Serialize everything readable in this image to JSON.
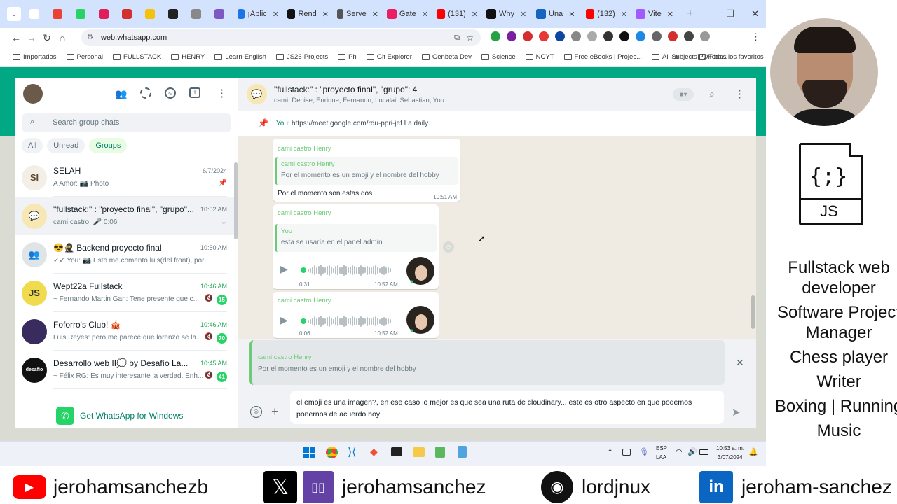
{
  "browser": {
    "tabs": [
      {
        "label": "",
        "color": "#ffffff"
      },
      {
        "label": "",
        "color": "#ea4335"
      },
      {
        "label": "",
        "color": "#25d366"
      },
      {
        "label": "",
        "color": "#e01e5a"
      },
      {
        "label": "",
        "color": "#d32f2f"
      },
      {
        "label": "",
        "color": "#f4c20d"
      },
      {
        "label": "",
        "color": "#222222"
      },
      {
        "label": "",
        "color": "#888888"
      },
      {
        "label": "",
        "color": "#7e57c2"
      },
      {
        "label": "¡Aplic",
        "color": "#1a73e8"
      },
      {
        "label": "Rend",
        "color": "#111111"
      },
      {
        "label": "Serve",
        "color": "#555555"
      },
      {
        "label": "Gate",
        "color": "#e91e63"
      },
      {
        "label": "(131)",
        "color": "#ff0000"
      },
      {
        "label": "Why",
        "color": "#111111"
      },
      {
        "label": "Una",
        "color": "#1565c0"
      },
      {
        "label": "(132)",
        "color": "#ff0000"
      },
      {
        "label": "Vite",
        "color": "#a259ff"
      }
    ],
    "url": "web.whatsapp.com",
    "bookmarks": [
      "Importados",
      "Personal",
      "FULLSTACK",
      "HENRY",
      "Learn-English",
      "JS26-Projects",
      "Ph",
      "Git Explorer",
      "Genbeta Dev",
      "Science",
      "NCYT",
      "Free eBooks | Projec...",
      "All Subjects PDF bo..."
    ],
    "bookmarks_more": "»",
    "all_bookmarks": "Todos los favoritos"
  },
  "sidebar": {
    "search_placeholder": "Search group chats",
    "filters": [
      "All",
      "Unread",
      "Groups"
    ],
    "chats": [
      {
        "name": "SELAH",
        "time": "6/7/2024",
        "msg": "A Amor: 📷 Photo",
        "avatar": "SI",
        "avatar_bg": "#f3efe6",
        "avatar_fg": "#5a4a2a",
        "badge": "",
        "pin": true
      },
      {
        "name": "\"fullstack:\" : \"proyecto final\", \"grupo\"...",
        "time": "10:52 AM",
        "msg": "cami castro: 🎤 0:06",
        "avatar": "💬",
        "avatar_bg": "#f7e7b5",
        "avatar_fg": "#777",
        "badge": "",
        "selected": true
      },
      {
        "name": "😎🥷 Backend proyecto final",
        "time": "10:50 AM",
        "msg": "✓✓ You: 📷 Esto me comentó luis(del front), por inter...",
        "avatar": "👥",
        "avatar_bg": "#dfe5e7",
        "avatar_fg": "#fff",
        "badge": ""
      },
      {
        "name": "Wept22a Fullstack",
        "time": "10:46 AM",
        "msg": "~ Fernando Martin Gan: Tene presente que c...",
        "avatar": "JS",
        "avatar_bg": "#f0db4f",
        "avatar_fg": "#323330",
        "badge": "15"
      },
      {
        "name": "Foforro's Club! 🎪",
        "time": "10:46 AM",
        "msg": "Luis Reyes: pero me parece que lorenzo se la...",
        "avatar": "",
        "avatar_bg": "#3a2b5e",
        "avatar_fg": "#fff",
        "badge": "70"
      },
      {
        "name": "Desarrollo web II💭   by Desafío La...",
        "time": "10:45 AM",
        "msg": "~ Félix RG: Es muy interesante la verdad. Enh...",
        "avatar": "desafío",
        "avatar_bg": "#111111",
        "avatar_fg": "#fff",
        "badge": "41"
      }
    ],
    "get_app": "Get WhatsApp for Windows"
  },
  "chat": {
    "title": "\"fullstack:\" : \"proyecto final\", \"grupo\": 4",
    "members": "cami, Denise, Enrique, Fernando, Lucalai, Sebastian, You",
    "pinned_sender": "You:",
    "pinned_text": "https://meet.google.com/rdu-ppri-jef La daily.",
    "messages": {
      "m1_sender": "cami castro Henry",
      "m1_quote_name": "cami castro Henry",
      "m1_quote_text": "Por el momento es un emoji y el nombre del hobby",
      "m1_text": "Por el momento son estas dos",
      "m1_time": "10:51 AM",
      "m2_sender": "cami castro Henry",
      "m2_quote_name": "You",
      "m2_quote_text": "esta se usaría en el panel admin",
      "m2_duration": "0:31",
      "m2_time": "10:52 AM",
      "m3_sender": "cami castro Henry",
      "m3_duration": "0:06",
      "m3_time": "10:52 AM"
    },
    "reply_name": "cami castro Henry",
    "reply_text": "Por el momento es un emoji y el nombre del hobby",
    "composer_text": "el emoji es una imagen?, en ese caso lo mejor es que sea una ruta de cloudinary... este es otro aspecto en que podemos ponernos de acuerdo hoy"
  },
  "taskbar": {
    "lang1": "ESP",
    "lang2": "LAA",
    "time": "10:53 a. m.",
    "date": "3/07/2024"
  },
  "profile": {
    "lines": [
      "Fullstack web",
      "developer",
      "Software Project",
      "Manager",
      "Chess player",
      "Writer",
      "Boxing | Running",
      "Music"
    ],
    "js_label": "JS",
    "js_braces": "{;}"
  },
  "social": {
    "youtube": "jerohamsanchezb",
    "x_twitch": "jerohamsanchez",
    "github": "lordjnux",
    "linkedin": "jeroham-sanchez"
  }
}
